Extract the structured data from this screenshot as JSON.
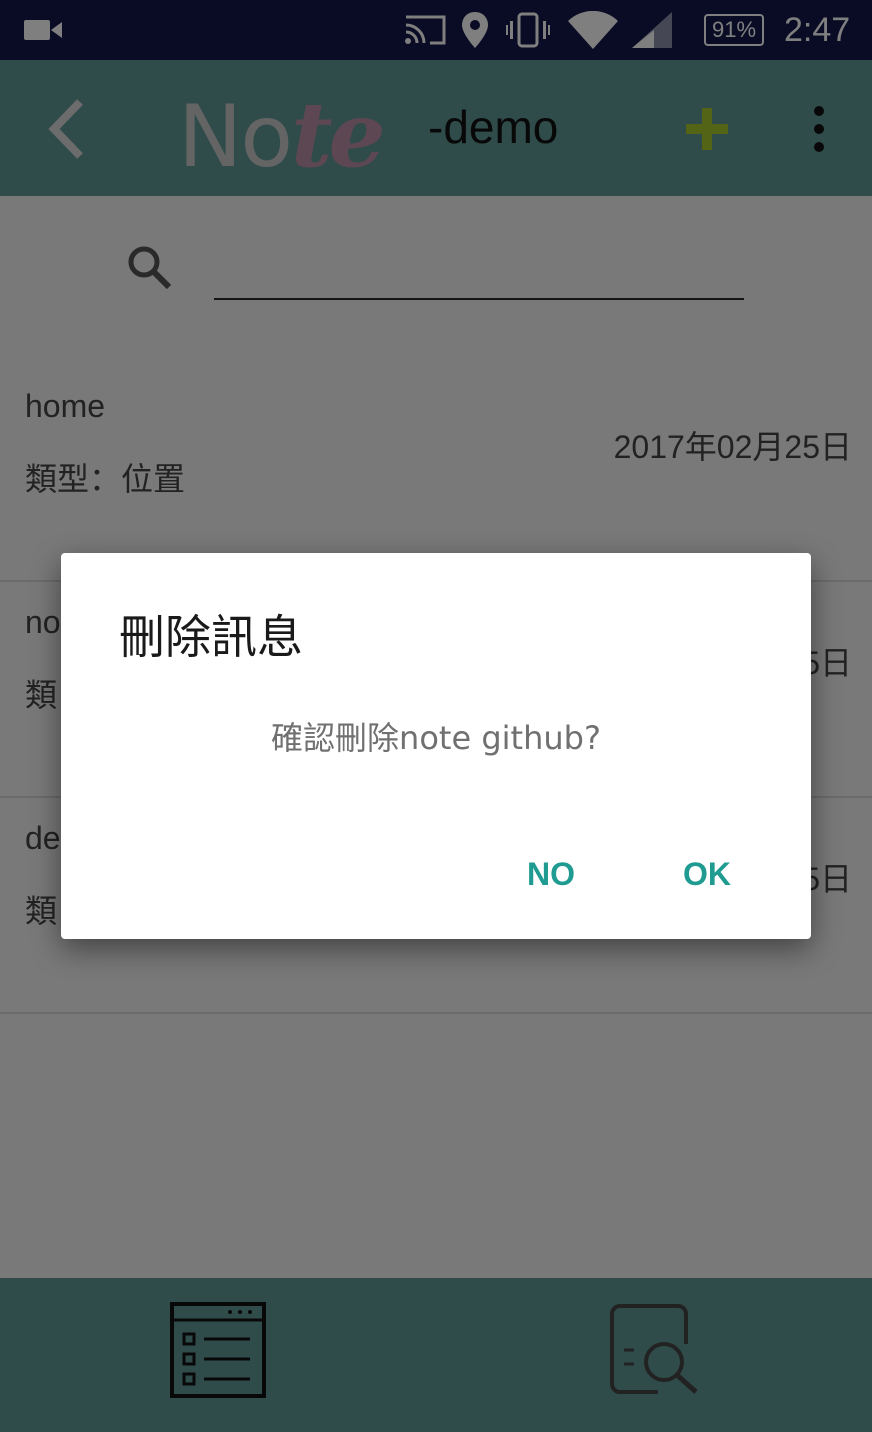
{
  "status_bar": {
    "icons": [
      "video-camera-icon",
      "cast-icon",
      "location-pin-icon",
      "vibrate-icon",
      "wifi-icon",
      "cellular-signal-icon"
    ],
    "battery": "91%",
    "time": "2:47"
  },
  "toolbar": {
    "logo_text_left": "No",
    "logo_text_right": "te",
    "subtitle": "-demo",
    "add_icon": "plus-icon",
    "menu_icon": "more-vert-icon",
    "back_icon": "chevron-left-icon"
  },
  "search": {
    "value": "",
    "placeholder": ""
  },
  "notes": [
    {
      "name": "home",
      "type": "類型：位置",
      "date": "2017年02月25日"
    },
    {
      "name": "no",
      "type": "類",
      "date": "5日"
    },
    {
      "name": "de",
      "type": "類",
      "date": "5日"
    }
  ],
  "bottom_nav": {
    "items": [
      "list-view-icon",
      "search-document-icon"
    ]
  },
  "dialog": {
    "title": "刪除訊息",
    "message": "確認刪除note github?",
    "no_label": "NO",
    "ok_label": "OK"
  },
  "colors": {
    "status_bar": "#14184a",
    "toolbar": "#5f9794",
    "accent": "#1f9b91",
    "plus": "#a6c92c"
  }
}
